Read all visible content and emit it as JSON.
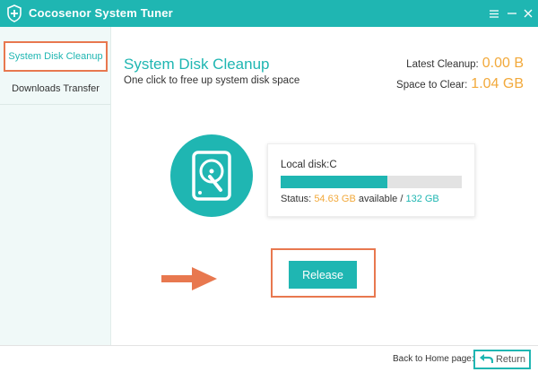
{
  "window": {
    "title": "Cocosenor System Tuner",
    "icons": [
      "shield-cross-icon",
      "menu-icon",
      "minimize-icon",
      "close-icon"
    ]
  },
  "sidebar": {
    "items": [
      {
        "label": "System Disk Cleanup",
        "active": true
      },
      {
        "label": "Downloads Transfer",
        "active": false
      }
    ]
  },
  "main": {
    "title": "System Disk Cleanup",
    "subtitle": "One click to free up system disk space",
    "stats": {
      "latest_cleanup_label": "Latest Cleanup:",
      "latest_cleanup_value": "0.00 B",
      "space_to_clear_label": "Space to Clear:",
      "space_to_clear_value": "1.04 GB"
    }
  },
  "disk": {
    "icon": "hard-disk-icon",
    "label": "Local disk:C",
    "status_label": "Status:",
    "available": "54.63 GB",
    "available_text": "available",
    "separator": "/",
    "total": "132 GB",
    "used_fraction": 0.59
  },
  "actions": {
    "release_label": "Release",
    "arrow_icon": "arrow-right-icon"
  },
  "footer": {
    "back_label": "Back to Home page:",
    "return_label": "Return",
    "return_icon": "return-arrow-icon"
  },
  "colors": {
    "accent": "#1fb6b2",
    "highlight": "#f2a93b",
    "annotation": "#e8784f"
  }
}
